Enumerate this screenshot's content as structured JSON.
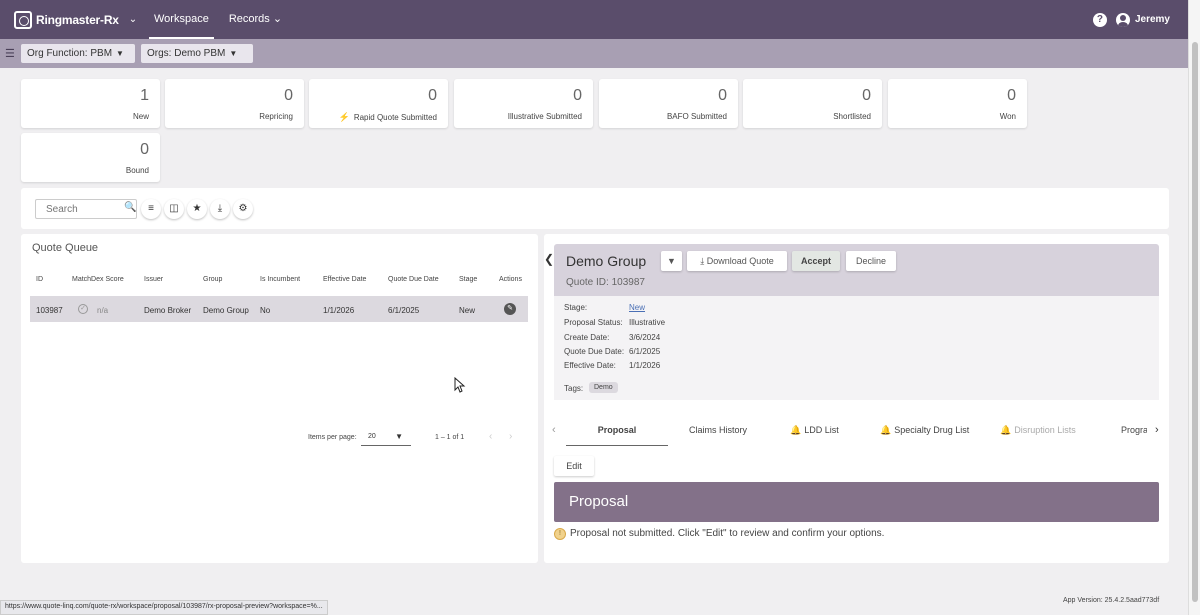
{
  "nav": {
    "brand": "Ringmaster-Rx",
    "items": [
      {
        "label": "Workspace",
        "active": true
      },
      {
        "label": "Records",
        "caret": true
      }
    ],
    "help": "?",
    "user": "Jeremy"
  },
  "filters": [
    {
      "label": "Org Function: PBM"
    },
    {
      "label": "Orgs: Demo PBM"
    }
  ],
  "stats": [
    {
      "value": "1",
      "label": "New"
    },
    {
      "value": "0",
      "label": "Repricing"
    },
    {
      "value": "0",
      "label": "Rapid Quote Submitted",
      "icon": "bolt"
    },
    {
      "value": "0",
      "label": "Illustrative Submitted"
    },
    {
      "value": "0",
      "label": "BAFO Submitted"
    },
    {
      "value": "0",
      "label": "Shortlisted"
    },
    {
      "value": "0",
      "label": "Won"
    },
    {
      "value": "0",
      "label": "Bound"
    }
  ],
  "toolbar": {
    "search_placeholder": "Search"
  },
  "queue": {
    "title": "Quote Queue",
    "columns": [
      "ID",
      "MatchDex Score",
      "Issuer",
      "Group",
      "Is Incumbent",
      "Effective Date",
      "Quote Due Date",
      "Stage",
      "Actions"
    ],
    "rows": [
      {
        "id": "103987",
        "score": "n/a",
        "issuer": "Demo Broker",
        "group": "Demo Group",
        "incumbent": "No",
        "effective": "1/1/2026",
        "due": "6/1/2025",
        "stage": "New"
      }
    ],
    "items_per_page_label": "Items per page:",
    "items_per_page": "20",
    "range": "1 – 1 of 1"
  },
  "detail": {
    "title": "Demo Group",
    "quote_id": "Quote ID: 103987",
    "buttons": {
      "download": "Download Quote",
      "accept": "Accept",
      "decline": "Decline"
    },
    "info": [
      {
        "label": "Stage:",
        "value": "New",
        "link": true
      },
      {
        "label": "Proposal Status:",
        "value": "Illustrative"
      },
      {
        "label": "Create Date:",
        "value": "3/6/2024"
      },
      {
        "label": "Quote Due Date:",
        "value": "6/1/2025"
      },
      {
        "label": "Effective Date:",
        "value": "1/1/2026"
      }
    ],
    "tags_label": "Tags:",
    "tags": [
      "Demo"
    ],
    "tabs": [
      {
        "label": "Proposal",
        "active": true
      },
      {
        "label": "Claims History"
      },
      {
        "label": "LDD List",
        "icon": "bell"
      },
      {
        "label": "Specialty Drug List",
        "icon": "bell"
      },
      {
        "label": "Disruption Lists",
        "icon": "bell",
        "disabled": true
      },
      {
        "label": "Progra"
      }
    ],
    "edit_label": "Edit",
    "section_title": "Proposal",
    "warning": "Proposal not submitted. Click \"Edit\" to review and confirm your options."
  },
  "footer": {
    "app_version": "App Version: 25.4.2.5aad773df",
    "status_url": "https://www.quote-linq.com/quote-rx/workspace/proposal/103987/rx-proposal-preview?workspace=%..."
  }
}
